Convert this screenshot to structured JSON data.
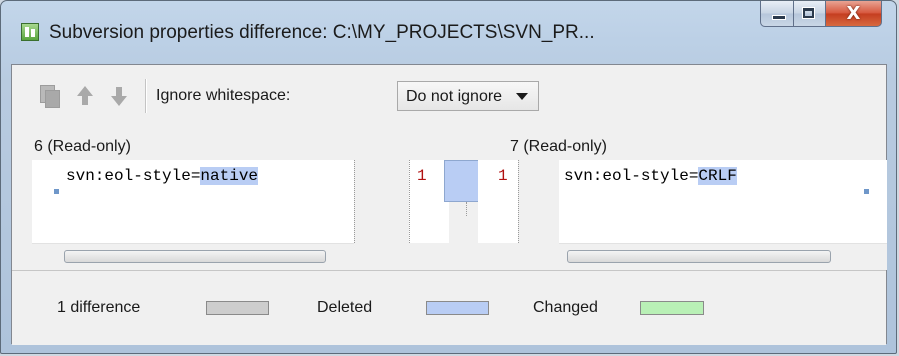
{
  "window": {
    "title": "Subversion properties difference: C:\\MY_PROJECTS\\SVN_PR...",
    "icon": "svn-diff-app-icon",
    "controls": {
      "minimize": "minimize-icon",
      "maximize": "maximize-icon",
      "close_glyph": "X"
    }
  },
  "toolbar": {
    "icons": [
      "copy-icon",
      "arrow-up-icon",
      "arrow-down-icon"
    ],
    "ignore_label": "Ignore whitespace:",
    "ignore_value": "Do not ignore"
  },
  "panes": {
    "left": {
      "header": "6 (Read-only)",
      "line_number": "1",
      "text_prefix": "svn:eol-style=",
      "text_highlight": "native"
    },
    "right": {
      "header": "7 (Read-only)",
      "line_number": "1",
      "text_prefix": "svn:eol-style=",
      "text_highlight": "CRLF"
    }
  },
  "status": {
    "difference_count": "1 difference",
    "deleted_label": "Deleted",
    "changed_label": "Changed"
  },
  "colors": {
    "highlight": "#b9cdf4",
    "count_swatch": "#cdcdcd",
    "deleted_swatch": "#b9cdf4",
    "changed_swatch": "#b9f0b6",
    "line_number": "#b01010"
  }
}
